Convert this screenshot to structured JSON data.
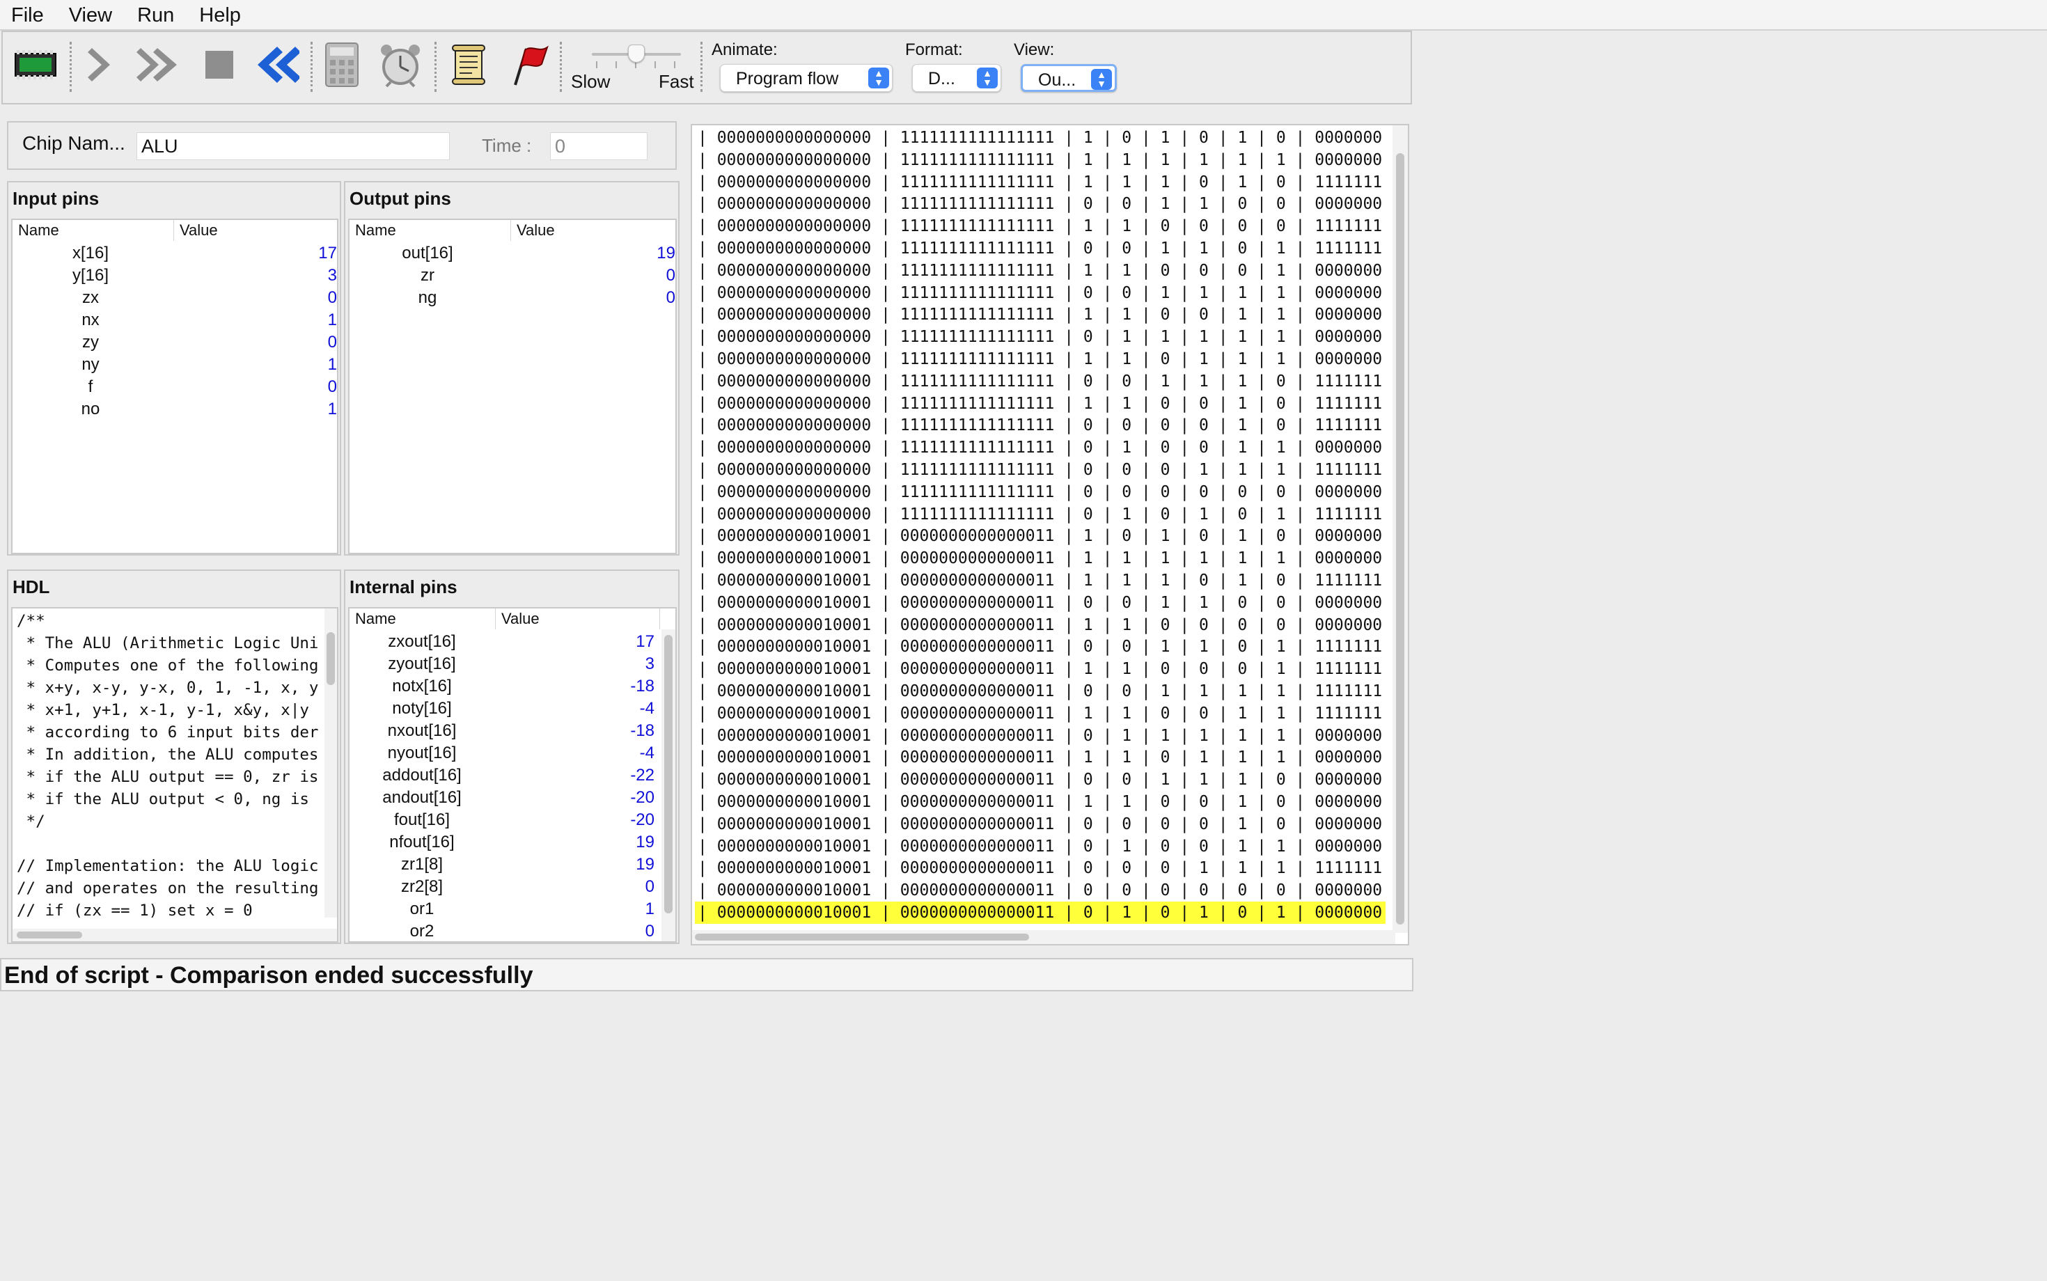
{
  "menu": {
    "items": [
      "File",
      "View",
      "Run",
      "Help"
    ]
  },
  "toolbar": {
    "buttons": [
      {
        "name": "load-chip",
        "icon": "chip-icon"
      },
      {
        "name": "single-step",
        "icon": "single-step-arrow-icon"
      },
      {
        "name": "run",
        "icon": "double-arrow-icon"
      },
      {
        "name": "stop",
        "icon": "stop-square-icon"
      },
      {
        "name": "reset",
        "icon": "rewind-icon"
      },
      {
        "name": "eval",
        "icon": "calculator-icon"
      },
      {
        "name": "clock",
        "icon": "alarm-clock-icon"
      },
      {
        "name": "script",
        "icon": "script-scroll-icon"
      },
      {
        "name": "breakpoints",
        "icon": "breakpoint-flag-icon"
      }
    ],
    "speed": {
      "slow_label": "Slow",
      "fast_label": "Fast",
      "level": 0.5
    },
    "animate": {
      "label": "Animate:",
      "value": "Program flow"
    },
    "format": {
      "label": "Format:",
      "value": "D..."
    },
    "view": {
      "label": "View:",
      "value": "Ou..."
    }
  },
  "chip": {
    "name_label": "Chip Nam...",
    "name_value": "ALU",
    "time_label": "Time :",
    "time_value": "0"
  },
  "input_pins": {
    "title": "Input pins",
    "col_name": "Name",
    "col_value": "Value",
    "rows": [
      {
        "name": "x[16]",
        "value": "17"
      },
      {
        "name": "y[16]",
        "value": "3"
      },
      {
        "name": "zx",
        "value": "0"
      },
      {
        "name": "nx",
        "value": "1"
      },
      {
        "name": "zy",
        "value": "0"
      },
      {
        "name": "ny",
        "value": "1"
      },
      {
        "name": "f",
        "value": "0"
      },
      {
        "name": "no",
        "value": "1"
      }
    ]
  },
  "output_pins": {
    "title": "Output pins",
    "col_name": "Name",
    "col_value": "Value",
    "rows": [
      {
        "name": "out[16]",
        "value": "19"
      },
      {
        "name": "zr",
        "value": "0"
      },
      {
        "name": "ng",
        "value": "0"
      }
    ]
  },
  "hdl": {
    "title": "HDL",
    "lines": [
      "/**",
      " * The ALU (Arithmetic Logic Uni",
      " * Computes one of the following",
      " * x+y, x-y, y-x, 0, 1, -1, x, y",
      " * x+1, y+1, x-1, y-1, x&y, x|y",
      " * according to 6 input bits der",
      " * In addition, the ALU computes",
      " * if the ALU output == 0, zr is",
      " * if the ALU output < 0, ng is",
      " */",
      "",
      "// Implementation: the ALU logic",
      "// and operates on the resulting",
      "// if (zx == 1) set x = 0"
    ]
  },
  "internal_pins": {
    "title": "Internal pins",
    "col_name": "Name",
    "col_value": "Value",
    "rows": [
      {
        "name": "zxout[16]",
        "value": "17"
      },
      {
        "name": "zyout[16]",
        "value": "3"
      },
      {
        "name": "notx[16]",
        "value": "-18"
      },
      {
        "name": "noty[16]",
        "value": "-4"
      },
      {
        "name": "nxout[16]",
        "value": "-18"
      },
      {
        "name": "nyout[16]",
        "value": "-4"
      },
      {
        "name": "addout[16]",
        "value": "-22"
      },
      {
        "name": "andout[16]",
        "value": "-20"
      },
      {
        "name": "fout[16]",
        "value": "-20"
      },
      {
        "name": "nfout[16]",
        "value": "19"
      },
      {
        "name": "zr1[8]",
        "value": "19"
      },
      {
        "name": "zr2[8]",
        "value": "0"
      },
      {
        "name": "or1",
        "value": "1"
      },
      {
        "name": "or2",
        "value": "0"
      }
    ]
  },
  "comparison": {
    "rows": [
      "| 0000000000000000 | 1111111111111111 | 1 | 0 | 1 | 0 | 1 | 0 | 0000000",
      "| 0000000000000000 | 1111111111111111 | 1 | 1 | 1 | 1 | 1 | 1 | 0000000",
      "| 0000000000000000 | 1111111111111111 | 1 | 1 | 1 | 0 | 1 | 0 | 1111111",
      "| 0000000000000000 | 1111111111111111 | 0 | 0 | 1 | 1 | 0 | 0 | 0000000",
      "| 0000000000000000 | 1111111111111111 | 1 | 1 | 0 | 0 | 0 | 0 | 1111111",
      "| 0000000000000000 | 1111111111111111 | 0 | 0 | 1 | 1 | 0 | 1 | 1111111",
      "| 0000000000000000 | 1111111111111111 | 1 | 1 | 0 | 0 | 0 | 1 | 0000000",
      "| 0000000000000000 | 1111111111111111 | 0 | 0 | 1 | 1 | 1 | 1 | 0000000",
      "| 0000000000000000 | 1111111111111111 | 1 | 1 | 0 | 0 | 1 | 1 | 0000000",
      "| 0000000000000000 | 1111111111111111 | 0 | 1 | 1 | 1 | 1 | 1 | 0000000",
      "| 0000000000000000 | 1111111111111111 | 1 | 1 | 0 | 1 | 1 | 1 | 0000000",
      "| 0000000000000000 | 1111111111111111 | 0 | 0 | 1 | 1 | 1 | 0 | 1111111",
      "| 0000000000000000 | 1111111111111111 | 1 | 1 | 0 | 0 | 1 | 0 | 1111111",
      "| 0000000000000000 | 1111111111111111 | 0 | 0 | 0 | 0 | 1 | 0 | 1111111",
      "| 0000000000000000 | 1111111111111111 | 0 | 1 | 0 | 0 | 1 | 1 | 0000000",
      "| 0000000000000000 | 1111111111111111 | 0 | 0 | 0 | 1 | 1 | 1 | 1111111",
      "| 0000000000000000 | 1111111111111111 | 0 | 0 | 0 | 0 | 0 | 0 | 0000000",
      "| 0000000000000000 | 1111111111111111 | 0 | 1 | 0 | 1 | 0 | 1 | 1111111",
      "| 0000000000010001 | 0000000000000011 | 1 | 0 | 1 | 0 | 1 | 0 | 0000000",
      "| 0000000000010001 | 0000000000000011 | 1 | 1 | 1 | 1 | 1 | 1 | 0000000",
      "| 0000000000010001 | 0000000000000011 | 1 | 1 | 1 | 0 | 1 | 0 | 1111111",
      "| 0000000000010001 | 0000000000000011 | 0 | 0 | 1 | 1 | 0 | 0 | 0000000",
      "| 0000000000010001 | 0000000000000011 | 1 | 1 | 0 | 0 | 0 | 0 | 0000000",
      "| 0000000000010001 | 0000000000000011 | 0 | 0 | 1 | 1 | 0 | 1 | 1111111",
      "| 0000000000010001 | 0000000000000011 | 1 | 1 | 0 | 0 | 0 | 1 | 1111111",
      "| 0000000000010001 | 0000000000000011 | 0 | 0 | 1 | 1 | 1 | 1 | 1111111",
      "| 0000000000010001 | 0000000000000011 | 1 | 1 | 0 | 0 | 1 | 1 | 1111111",
      "| 0000000000010001 | 0000000000000011 | 0 | 1 | 1 | 1 | 1 | 1 | 0000000",
      "| 0000000000010001 | 0000000000000011 | 1 | 1 | 0 | 1 | 1 | 1 | 0000000",
      "| 0000000000010001 | 0000000000000011 | 0 | 0 | 1 | 1 | 1 | 0 | 0000000",
      "| 0000000000010001 | 0000000000000011 | 1 | 1 | 0 | 0 | 1 | 0 | 0000000",
      "| 0000000000010001 | 0000000000000011 | 0 | 0 | 0 | 0 | 1 | 0 | 0000000",
      "| 0000000000010001 | 0000000000000011 | 0 | 1 | 0 | 0 | 1 | 1 | 0000000",
      "| 0000000000010001 | 0000000000000011 | 0 | 0 | 0 | 1 | 1 | 1 | 1111111",
      "| 0000000000010001 | 0000000000000011 | 0 | 0 | 0 | 0 | 0 | 0 | 0000000",
      "| 0000000000010001 | 0000000000000011 | 0 | 1 | 0 | 1 | 0 | 1 | 0000000"
    ],
    "highlight_color": "#ffff3a"
  },
  "status": {
    "message": "End of script - Comparison ended successfully"
  },
  "colors": {
    "value_blue": "#1010d8",
    "combo_accent": "#3b82f6"
  }
}
